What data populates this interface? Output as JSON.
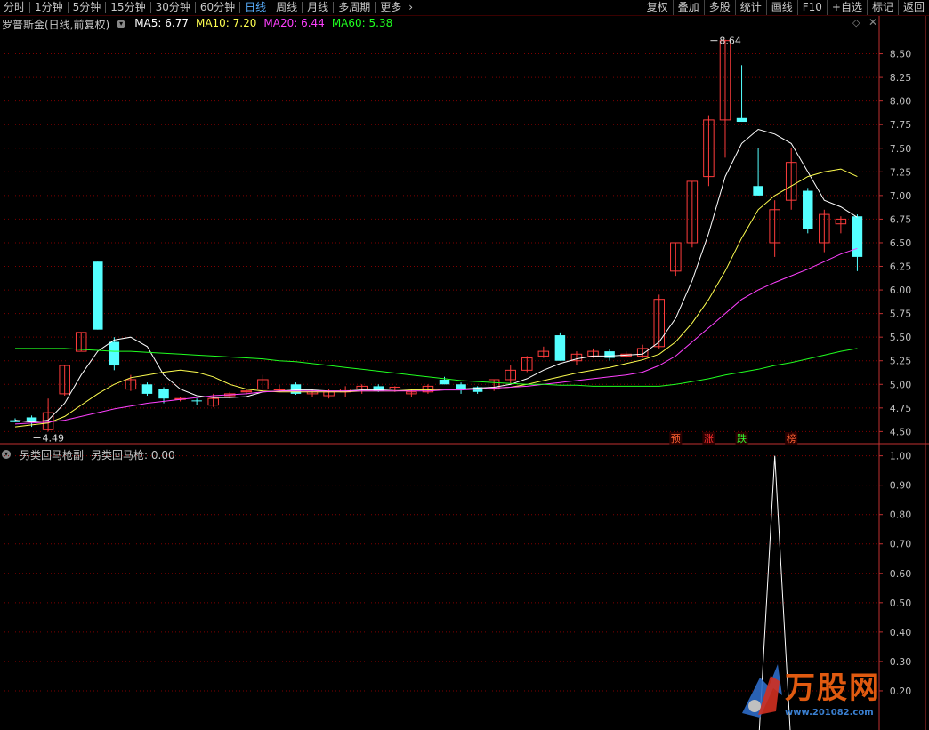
{
  "toolbar": {
    "periods": [
      "分时",
      "1分钟",
      "5分钟",
      "15分钟",
      "30分钟",
      "60分钟",
      "日线",
      "周线",
      "月线",
      "多周期",
      "更多"
    ],
    "active_period": "日线",
    "tools": [
      "复权",
      "叠加",
      "多股",
      "统计",
      "画线",
      "F10",
      "+自选",
      "标记",
      "返回"
    ]
  },
  "legend_main": {
    "name": "罗普斯金(日线,前复权)",
    "ma5": "MA5: 6.77",
    "ma10": "MA10: 7.20",
    "ma20": "MA20: 6.44",
    "ma60": "MA60: 5.38"
  },
  "legend_sub": {
    "name": "另类回马枪副",
    "value": "另类回马枪: 0.00"
  },
  "colors": {
    "up": "#ff3c3c",
    "down": "#54ffff",
    "ma5": "#ffffff",
    "ma10": "#ffff50",
    "ma20": "#ff40ff",
    "ma60": "#20ff20",
    "axis": "#c03030",
    "grid": "#800000"
  },
  "watermark": {
    "logo": "万股网",
    "url": "www.201082.com"
  },
  "chart_data": [
    {
      "type": "candlestick",
      "title": "罗普斯金(日线,前复权)",
      "ylim": [
        4.4,
        8.75
      ],
      "yticks": [
        4.5,
        4.75,
        5.0,
        5.25,
        5.5,
        5.75,
        6.0,
        6.25,
        6.5,
        6.75,
        7.0,
        7.25,
        7.5,
        7.75,
        8.0,
        8.25,
        8.5
      ],
      "annotations": [
        {
          "label": "4.49",
          "value": 4.49,
          "index": 1
        },
        {
          "label": "8.64",
          "value": 8.64,
          "index": 42
        }
      ],
      "markers": [
        {
          "label": "预",
          "index": 40,
          "color": "#ff6030"
        },
        {
          "label": "涨",
          "index": 42,
          "color": "#ff3030"
        },
        {
          "label": "跌",
          "index": 44,
          "color": "#30ff30"
        },
        {
          "label": "榜",
          "index": 47,
          "color": "#ff6030"
        }
      ],
      "candles": [
        [
          4.62,
          4.64,
          4.6,
          4.6
        ],
        [
          4.65,
          4.67,
          4.55,
          4.6
        ],
        [
          4.52,
          4.85,
          4.5,
          4.7
        ],
        [
          4.9,
          5.2,
          4.88,
          5.2
        ],
        [
          5.35,
          5.55,
          5.35,
          5.55
        ],
        [
          6.3,
          6.3,
          5.58,
          5.58
        ],
        [
          5.45,
          5.5,
          5.15,
          5.2
        ],
        [
          4.95,
          5.1,
          4.93,
          5.05
        ],
        [
          5.0,
          5.02,
          4.88,
          4.9
        ],
        [
          4.95,
          4.97,
          4.8,
          4.85
        ],
        [
          4.85,
          4.87,
          4.82,
          4.85
        ],
        [
          4.83,
          4.85,
          4.78,
          4.82
        ],
        [
          4.78,
          4.9,
          4.76,
          4.85
        ],
        [
          4.88,
          4.92,
          4.85,
          4.9
        ],
        [
          4.92,
          4.95,
          4.89,
          4.93
        ],
        [
          4.95,
          5.1,
          4.95,
          5.05
        ],
        [
          4.95,
          5.0,
          4.92,
          4.95
        ],
        [
          5.0,
          5.02,
          4.89,
          4.9
        ],
        [
          4.9,
          4.95,
          4.87,
          4.92
        ],
        [
          4.88,
          4.95,
          4.85,
          4.92
        ],
        [
          4.92,
          4.98,
          4.87,
          4.95
        ],
        [
          4.95,
          5.0,
          4.9,
          4.98
        ],
        [
          4.98,
          5.0,
          4.92,
          4.93
        ],
        [
          4.95,
          4.98,
          4.92,
          4.97
        ],
        [
          4.9,
          4.95,
          4.87,
          4.92
        ],
        [
          4.92,
          5.0,
          4.9,
          4.98
        ],
        [
          5.05,
          5.08,
          5.0,
          5.0
        ],
        [
          5.0,
          5.02,
          4.9,
          4.95
        ],
        [
          4.97,
          4.98,
          4.9,
          4.92
        ],
        [
          4.95,
          5.05,
          4.93,
          5.05
        ],
        [
          5.05,
          5.2,
          5.0,
          5.15
        ],
        [
          5.15,
          5.3,
          5.13,
          5.28
        ],
        [
          5.3,
          5.4,
          5.28,
          5.35
        ],
        [
          5.52,
          5.55,
          5.25,
          5.25
        ],
        [
          5.25,
          5.35,
          5.2,
          5.32
        ],
        [
          5.3,
          5.38,
          5.28,
          5.35
        ],
        [
          5.35,
          5.37,
          5.25,
          5.28
        ],
        [
          5.3,
          5.35,
          5.28,
          5.32
        ],
        [
          5.3,
          5.42,
          5.28,
          5.38
        ],
        [
          5.4,
          5.95,
          5.38,
          5.9
        ],
        [
          6.2,
          6.5,
          6.15,
          6.5
        ],
        [
          6.5,
          7.15,
          6.45,
          7.15
        ],
        [
          7.2,
          7.85,
          7.1,
          7.8
        ],
        [
          7.8,
          8.65,
          7.4,
          8.64
        ],
        [
          7.82,
          8.38,
          7.78,
          7.78
        ],
        [
          7.1,
          7.5,
          7.0,
          7.0
        ],
        [
          6.5,
          6.95,
          6.35,
          6.85
        ],
        [
          6.95,
          7.5,
          6.85,
          7.35
        ],
        [
          7.05,
          7.08,
          6.6,
          6.65
        ],
        [
          6.5,
          6.85,
          6.4,
          6.8
        ],
        [
          6.7,
          6.78,
          6.6,
          6.75
        ],
        [
          6.78,
          6.8,
          6.2,
          6.35
        ]
      ],
      "series": [
        {
          "name": "MA5",
          "values": [
            4.62,
            4.6,
            4.62,
            4.8,
            5.1,
            5.35,
            5.47,
            5.5,
            5.4,
            5.1,
            4.95,
            4.88,
            4.86,
            4.86,
            4.87,
            4.92,
            4.93,
            4.94,
            4.94,
            4.93,
            4.93,
            4.94,
            4.94,
            4.95,
            4.95,
            4.95,
            4.95,
            4.95,
            4.96,
            4.97,
            5.0,
            5.06,
            5.15,
            5.22,
            5.27,
            5.3,
            5.3,
            5.31,
            5.32,
            5.45,
            5.7,
            6.1,
            6.6,
            7.2,
            7.55,
            7.7,
            7.65,
            7.55,
            7.25,
            6.95,
            6.88,
            6.77
          ]
        },
        {
          "name": "MA10",
          "values": [
            4.55,
            4.57,
            4.59,
            4.66,
            4.78,
            4.9,
            5.0,
            5.07,
            5.1,
            5.13,
            5.15,
            5.13,
            5.08,
            5.0,
            4.95,
            4.93,
            4.92,
            4.92,
            4.92,
            4.92,
            4.92,
            4.93,
            4.93,
            4.93,
            4.94,
            4.94,
            4.95,
            4.95,
            4.95,
            4.96,
            4.97,
            5.0,
            5.04,
            5.08,
            5.12,
            5.15,
            5.18,
            5.22,
            5.26,
            5.32,
            5.45,
            5.65,
            5.9,
            6.2,
            6.55,
            6.85,
            7.0,
            7.1,
            7.2,
            7.25,
            7.28,
            7.2
          ]
        },
        {
          "name": "MA20",
          "values": [
            4.58,
            4.59,
            4.6,
            4.62,
            4.66,
            4.7,
            4.74,
            4.77,
            4.8,
            4.82,
            4.84,
            4.86,
            4.88,
            4.89,
            4.9,
            4.92,
            4.93,
            4.93,
            4.93,
            4.93,
            4.93,
            4.93,
            4.93,
            4.93,
            4.93,
            4.93,
            4.94,
            4.94,
            4.95,
            4.96,
            4.97,
            4.98,
            5.0,
            5.02,
            5.04,
            5.06,
            5.08,
            5.1,
            5.13,
            5.2,
            5.3,
            5.45,
            5.6,
            5.75,
            5.9,
            6.0,
            6.08,
            6.15,
            6.22,
            6.3,
            6.38,
            6.44
          ]
        },
        {
          "name": "MA60",
          "values": [
            5.38,
            5.38,
            5.38,
            5.38,
            5.37,
            5.36,
            5.35,
            5.35,
            5.34,
            5.33,
            5.32,
            5.31,
            5.3,
            5.29,
            5.28,
            5.27,
            5.25,
            5.24,
            5.22,
            5.2,
            5.18,
            5.16,
            5.14,
            5.12,
            5.1,
            5.08,
            5.06,
            5.04,
            5.03,
            5.02,
            5.01,
            5.0,
            5.0,
            4.99,
            4.99,
            4.98,
            4.98,
            4.98,
            4.98,
            4.98,
            5.0,
            5.03,
            5.06,
            5.1,
            5.13,
            5.16,
            5.2,
            5.23,
            5.27,
            5.31,
            5.35,
            5.38
          ]
        }
      ]
    },
    {
      "type": "line",
      "title": "另类回马枪副",
      "ylim": [
        0.1,
        1.02
      ],
      "yticks": [
        0.2,
        0.3,
        0.4,
        0.5,
        0.6,
        0.7,
        0.8,
        0.9,
        1.0
      ],
      "series": [
        {
          "name": "另类回马枪",
          "values": [
            0,
            0,
            0,
            0,
            0,
            0,
            0,
            0,
            0,
            0,
            0,
            0,
            0,
            0,
            0,
            0,
            0,
            0,
            0,
            0,
            0,
            0,
            0,
            0,
            0,
            0,
            0,
            0,
            0,
            0,
            0,
            0,
            0,
            0,
            0,
            0,
            0,
            0,
            0,
            0,
            0,
            0,
            0,
            0,
            0,
            0,
            1,
            0,
            0,
            0,
            0,
            0
          ]
        }
      ]
    }
  ]
}
